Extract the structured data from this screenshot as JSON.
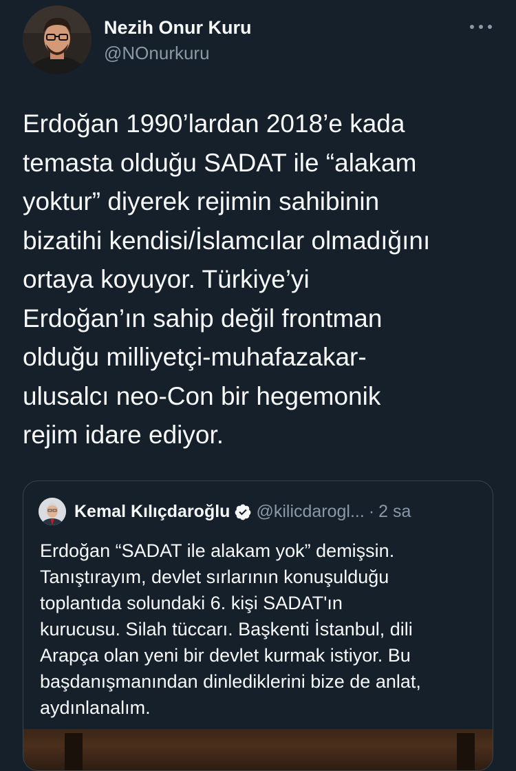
{
  "tweet": {
    "author": {
      "name": "Nezih Onur Kuru",
      "handle": "@NOnurkuru"
    },
    "more_icon": "more-horizontal-icon",
    "text": "Erdoğan 1990’lardan 2018’e kada\ntemasta olduğu SADAT ile “alakam\nyoktur” diyerek rejimin sahibinin\nbizatihi kendisi/İslamcılar olmadığını\nortaya koyuyor. Türkiye’yi\nErdoğan’ın sahip değil frontman\nolduğu milliyetçi-muhafazakar-\nulusalcı neo-Con bir hegemonik\nrejim idare ediyor."
  },
  "quoted_tweet": {
    "author": {
      "name": "Kemal Kılıçdaroğlu",
      "handle": "@kilicdarogl...",
      "verified_icon": "verified-badge-icon"
    },
    "separator": "·",
    "time": "2 sa",
    "text": "Erdoğan “SADAT ile alakam yok” demişsin.\nTanıştırayım, devlet sırlarının konuşulduğu\ntoplantıda solundaki 6. kişi SADAT'ın\nkurucusu. Silah tüccarı. Başkenti İstanbul, dili\nArapça olan yeni bir devlet kurmak istiyor. Bu\nbaşdanışmanından dinlediklerini bize de anlat,\naydınlanalım."
  },
  "colors": {
    "background": "#15202b",
    "text_primary": "#f7f9f9",
    "text_secondary": "#8b98a5",
    "border": "#38444d",
    "verified": "#f7f9f9"
  }
}
